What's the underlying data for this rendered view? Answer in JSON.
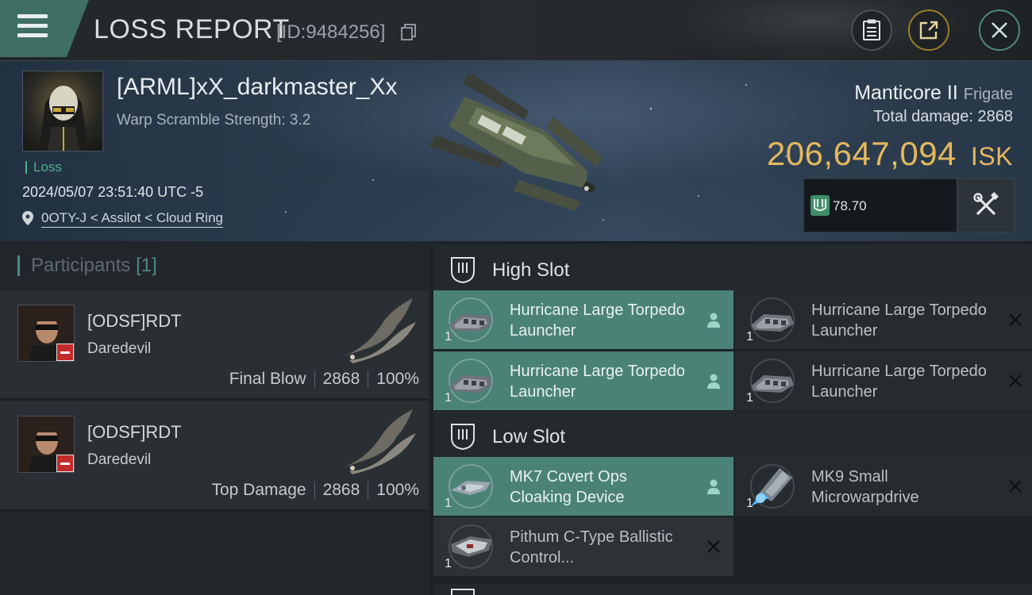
{
  "topbar": {
    "title": "LOSS REPORT",
    "report_id": "[ID:9484256]",
    "icons": [
      "menu-icon",
      "copy-icon",
      "clipboard-icon",
      "share-icon",
      "close-icon"
    ]
  },
  "victim": {
    "name": "[ARML]xX_darkmaster_Xx",
    "warp_scramble": "Warp Scramble Strength: 3.2",
    "status": "Loss",
    "timestamp": "2024/05/07 23:51:40 UTC -5",
    "location": "0OTY-J < Assilot < Cloud Ring"
  },
  "ship": {
    "name": "Manticore II",
    "class": "Frigate",
    "total_damage_label": "Total damage:",
    "total_damage": "2868",
    "isk_value": "206,647,094",
    "isk_unit": "ISK",
    "stat_value": "78.70"
  },
  "participants": {
    "heading": "Participants",
    "count": "[1]",
    "rows": [
      {
        "name": "[ODSF]RDT",
        "ship": "Daredevil",
        "role": "Final Blow",
        "damage": "2868",
        "percent": "100%"
      },
      {
        "name": "[ODSF]RDT",
        "ship": "Daredevil",
        "role": "Top Damage",
        "damage": "2868",
        "percent": "100%"
      }
    ]
  },
  "slots": {
    "high": {
      "label": "High Slot",
      "items": [
        {
          "name": "Hurricane Large Torpedo Launcher",
          "qty": "1",
          "state": "dropped",
          "status_icon": "person-icon"
        },
        {
          "name": "Hurricane Large Torpedo Launcher",
          "qty": "1",
          "state": "destroyed",
          "status_icon": "close-icon"
        },
        {
          "name": "Hurricane Large Torpedo Launcher",
          "qty": "1",
          "state": "dropped",
          "status_icon": "person-icon"
        },
        {
          "name": "Hurricane Large Torpedo Launcher",
          "qty": "1",
          "state": "destroyed",
          "status_icon": "close-icon"
        }
      ]
    },
    "low": {
      "label": "Low Slot",
      "items": [
        {
          "name": "MK7 Covert Ops Cloaking Device",
          "qty": "1",
          "state": "dropped",
          "status_icon": "person-icon"
        },
        {
          "name": "MK9 Small Microwarpdrive",
          "qty": "1",
          "state": "destroyed",
          "status_icon": "close-icon"
        },
        {
          "name": "Pithum C-Type Ballistic Control...",
          "qty": "1",
          "state": "destroyed",
          "status_icon": "close-icon"
        }
      ]
    }
  },
  "colors": {
    "accent": "#4b8276",
    "isk": "#e4b85e",
    "loss": "#4fb08f",
    "badge": "#c42a2a"
  }
}
